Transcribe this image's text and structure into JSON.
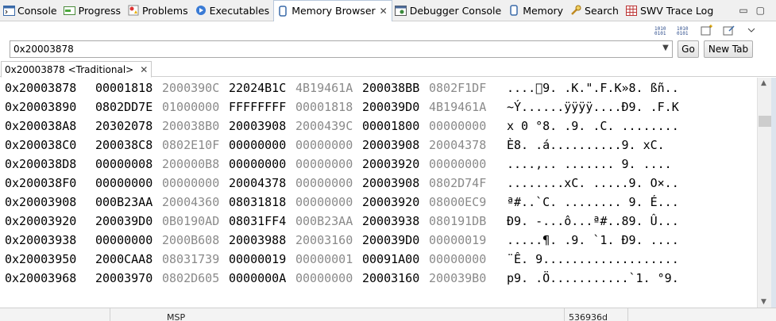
{
  "tabs": [
    {
      "label": "Console",
      "icon": "console-icon"
    },
    {
      "label": "Progress",
      "icon": "progress-icon"
    },
    {
      "label": "Problems",
      "icon": "problems-icon"
    },
    {
      "label": "Executables",
      "icon": "executables-icon"
    },
    {
      "label": "Memory Browser",
      "icon": "memory-browser-icon",
      "active": true
    },
    {
      "label": "Debugger Console",
      "icon": "debugger-console-icon"
    },
    {
      "label": "Memory",
      "icon": "memory-icon"
    },
    {
      "label": "Search",
      "icon": "search-icon"
    },
    {
      "label": "SWV Trace Log",
      "icon": "swv-trace-log-icon"
    }
  ],
  "address": {
    "value": "0x20003878"
  },
  "buttons": {
    "go": "Go",
    "new_tab": "New Tab"
  },
  "rendering_tab": {
    "label": "0x20003878 <Traditional>"
  },
  "rows": [
    {
      "addr": "0x20003878",
      "words": [
        "00001818",
        "2000390C",
        "22024B1C",
        "4B19461A",
        "200038BB",
        "0802F1DF"
      ],
      "dim": [
        false,
        true,
        false,
        true,
        false,
        true
      ],
      "ascii": "....\u00009. .K.\".F.K»8. ßñ.."
    },
    {
      "addr": "0x20003890",
      "words": [
        "0802DD7E",
        "01000000",
        "FFFFFFFF",
        "00001818",
        "200039D0",
        "4B19461A"
      ],
      "dim": [
        false,
        true,
        false,
        true,
        false,
        true
      ],
      "ascii": "~Ý......ÿÿÿÿ....Ð9. .F.K"
    },
    {
      "addr": "0x200038A8",
      "words": [
        "20302078",
        "200038B0",
        "20003908",
        "2000439C",
        "00001800",
        "00000000"
      ],
      "dim": [
        false,
        true,
        false,
        true,
        false,
        true
      ],
      "ascii": "x 0 °8. .9. .C. ........"
    },
    {
      "addr": "0x200038C0",
      "words": [
        "200038C8",
        "0802E10F",
        "00000000",
        "00000000",
        "20003908",
        "20004378"
      ],
      "dim": [
        false,
        true,
        false,
        true,
        false,
        true
      ],
      "ascii": "È8. .á..........9. xC."
    },
    {
      "addr": "0x200038D8",
      "words": [
        "00000008",
        "200000B8",
        "00000000",
        "00000000",
        "20003920",
        "00000000"
      ],
      "dim": [
        false,
        true,
        false,
        true,
        false,
        true
      ],
      "ascii": "....,.. ....... 9. ...."
    },
    {
      "addr": "0x200038F0",
      "words": [
        "00000000",
        "00000000",
        "20004378",
        "00000000",
        "20003908",
        "0802D74F"
      ],
      "dim": [
        false,
        true,
        false,
        true,
        false,
        true
      ],
      "ascii": "........xC. .....9. O×.."
    },
    {
      "addr": "0x20003908",
      "words": [
        "000B23AA",
        "20004360",
        "08031818",
        "00000000",
        "20003920",
        "08000EC9"
      ],
      "dim": [
        false,
        true,
        false,
        true,
        false,
        true
      ],
      "ascii": "ª#..`C. ........ 9. É..."
    },
    {
      "addr": "0x20003920",
      "words": [
        "200039D0",
        "0B0190AD",
        "08031FF4",
        "000B23AA",
        "20003938",
        "080191DB"
      ],
      "dim": [
        false,
        true,
        false,
        true,
        false,
        true
      ],
      "ascii": "Ð9. -...ô...ª#..89. Û..."
    },
    {
      "addr": "0x20003938",
      "words": [
        "00000000",
        "2000B608",
        "20003988",
        "20003160",
        "200039D0",
        "00000019"
      ],
      "dim": [
        false,
        true,
        false,
        true,
        false,
        true
      ],
      "ascii": ".....¶. .9. `1. Ð9. ...."
    },
    {
      "addr": "0x20003950",
      "words": [
        "2000CAA8",
        "08031739",
        "00000019",
        "00000001",
        "00091A00",
        "00000000"
      ],
      "dim": [
        false,
        true,
        false,
        true,
        false,
        true
      ],
      "ascii": "¨Ê. 9..................."
    },
    {
      "addr": "0x20003968",
      "words": [
        "20003970",
        "0802D605",
        "0000000A",
        "00000000",
        "20003160",
        "200039B0"
      ],
      "dim": [
        false,
        true,
        false,
        true,
        false,
        true
      ],
      "ascii": "p9. .Ö...........`1. °9."
    }
  ],
  "bottom": {
    "left_label": "MSP",
    "right_value": "536936d"
  },
  "colors": {
    "dim_text": "#8a8a8a",
    "active_tab_border": "#b8c8dc"
  }
}
